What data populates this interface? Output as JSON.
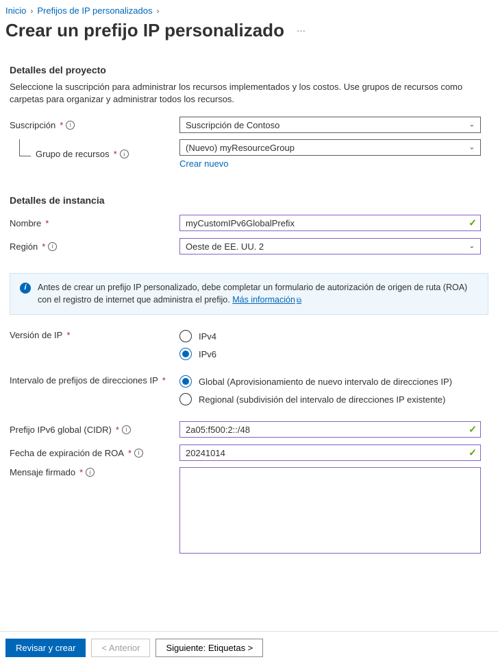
{
  "breadcrumb": {
    "home": "Inicio",
    "prefixes": "Prefijos de IP personalizados"
  },
  "page_title": "Crear un prefijo IP personalizado",
  "project": {
    "heading": "Detalles del proyecto",
    "description": "Seleccione la suscripción para administrar los recursos implementados y los costos. Use grupos de recursos como carpetas para organizar y administrar todos los recursos.",
    "subscription_label": "Suscripción",
    "subscription_value": "Suscripción de Contoso",
    "rg_label": "Grupo de recursos",
    "rg_value": "(Nuevo) myResourceGroup",
    "create_new": "Crear nuevo"
  },
  "instance": {
    "heading": "Detalles de instancia",
    "name_label": "Nombre",
    "name_value": "myCustomIPv6GlobalPrefix",
    "region_label": "Región",
    "region_value": "Oeste de EE. UU. 2"
  },
  "banner": {
    "text": "Antes de crear un prefijo IP personalizado, debe completar un formulario de autorización de origen de ruta (ROA) con el registro de internet que administra el prefijo.",
    "link": "Más información"
  },
  "ip_version": {
    "label": "Versión de IP",
    "ipv4": "IPv4",
    "ipv6": "IPv6"
  },
  "ip_range": {
    "label": "Intervalo de prefijos de direcciones IP",
    "global": "Global (Aprovisionamiento de nuevo intervalo de direcciones IP)",
    "regional": "Regional (subdivisión del intervalo de direcciones IP existente)"
  },
  "cidr": {
    "label": "Prefijo IPv6 global (CIDR)",
    "value": "2a05:f500:2::/48"
  },
  "roa": {
    "label": "Fecha de expiración de ROA",
    "value": "20241014"
  },
  "signed": {
    "label": "Mensaje firmado",
    "value": ""
  },
  "footer": {
    "review": "Revisar y crear",
    "prev": "< Anterior",
    "next": "Siguiente: Etiquetas >"
  }
}
